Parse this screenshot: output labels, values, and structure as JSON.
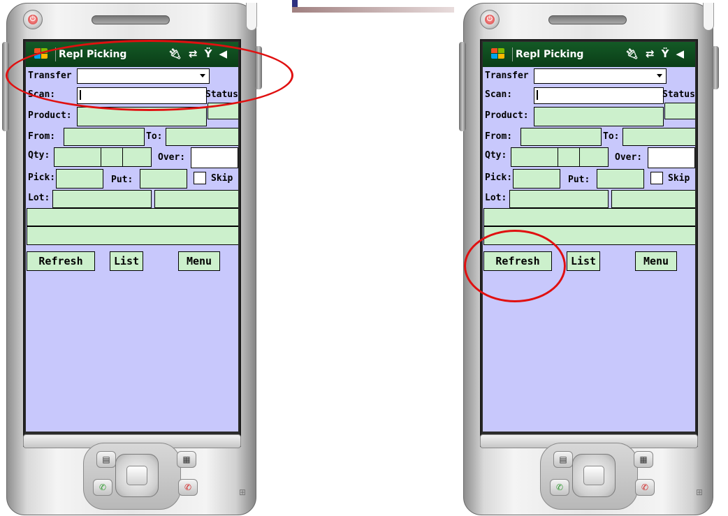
{
  "apps": [
    {
      "title": "Repl Picking",
      "status_icons": [
        "antenna-icon",
        "sync-icon",
        "no-signal-icon",
        "speaker-icon"
      ],
      "form": {
        "transfer_label": "Transfer",
        "scan_label": "Scan:",
        "status_label": "Status",
        "product_label": "Product:",
        "from_label": "From:",
        "to_label": "To:",
        "qty_label": "Qty:",
        "over_label": "Over:",
        "pick_label": "Pick:",
        "put_label": "Put:",
        "skip_label": "Skip",
        "lot_label": "Lot:"
      },
      "buttons": {
        "refresh": "Refresh",
        "list": "List",
        "menu": "Menu"
      }
    },
    {
      "title": "Repl Picking",
      "status_icons": [
        "antenna-icon",
        "sync-icon",
        "no-signal-icon",
        "speaker-icon"
      ],
      "form": {
        "transfer_label": "Transfer",
        "scan_label": "Scan:",
        "status_label": "Status",
        "product_label": "Product:",
        "from_label": "From:",
        "to_label": "To:",
        "qty_label": "Qty:",
        "over_label": "Over:",
        "pick_label": "Pick:",
        "put_label": "Put:",
        "skip_label": "Skip",
        "lot_label": "Lot:"
      },
      "buttons": {
        "refresh": "Refresh",
        "list": "List",
        "menu": "Menu"
      }
    }
  ],
  "colors": {
    "screen_bg": "#c8c8fc",
    "field_green": "#ccf0cc",
    "titlebar_green": "#0f4d1f",
    "annotation_red": "#e01010"
  }
}
